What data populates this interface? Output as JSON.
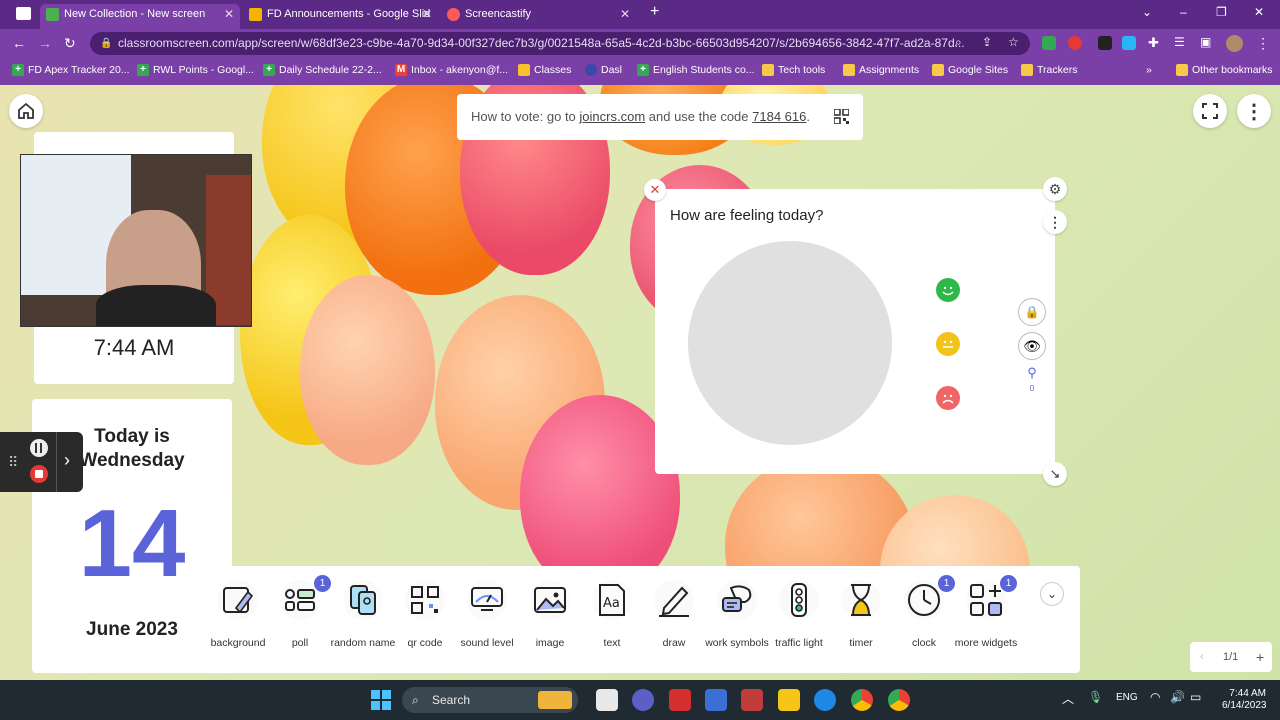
{
  "browser": {
    "tabs": [
      {
        "title": "New Collection - New screen",
        "active": true
      },
      {
        "title": "FD Announcements - Google Slid",
        "active": false
      },
      {
        "title": "Screencastify",
        "active": false
      }
    ],
    "url": "classroomscreen.com/app/screen/w/68df3e23-c9be-4a70-9d34-00f327dec7b3/g/0021548a-65a5-4c2d-b3bc-66503d954207/s/2b694656-3842-47f7-ad2a-87d...",
    "bookmarks": [
      "FD Apex Tracker 20...",
      "RWL Points - Googl...",
      "Daily Schedule 22-2...",
      "Inbox - akenyon@f...",
      "Classes",
      "Dasl",
      "English Students co...",
      "Tech tools",
      "Assignments",
      "Google Sites",
      "Trackers"
    ],
    "bookmarks_overflow": "»",
    "other_bookmarks": "Other bookmarks"
  },
  "vote": {
    "prefix": "How to vote: go to ",
    "site": "joincrs.com",
    "middle": " and use the code ",
    "code": "7184 616",
    "suffix": "."
  },
  "clock": {
    "time": "7:44 AM"
  },
  "date": {
    "line1": "Today is",
    "line2": "Wednesday",
    "day": "14",
    "month_year": "June 2023"
  },
  "poll": {
    "question": "How are feeling today?",
    "participants": "0",
    "options": [
      {
        "icon": "happy-face-icon",
        "color": "#2db84a"
      },
      {
        "icon": "neutral-face-icon",
        "color": "#f2c31a"
      },
      {
        "icon": "sad-face-icon",
        "color": "#f06666"
      }
    ]
  },
  "toolbar": {
    "tools": [
      {
        "label": "background",
        "badge": ""
      },
      {
        "label": "poll",
        "badge": "1"
      },
      {
        "label": "random name",
        "badge": ""
      },
      {
        "label": "qr code",
        "badge": ""
      },
      {
        "label": "sound level",
        "badge": ""
      },
      {
        "label": "image",
        "badge": ""
      },
      {
        "label": "text",
        "badge": ""
      },
      {
        "label": "draw",
        "badge": ""
      },
      {
        "label": "work symbols",
        "badge": ""
      },
      {
        "label": "traffic light",
        "badge": ""
      },
      {
        "label": "timer",
        "badge": ""
      },
      {
        "label": "clock",
        "badge": "1"
      },
      {
        "label": "more widgets",
        "badge": "1"
      }
    ]
  },
  "pager": {
    "label": "1/1",
    "add": "+",
    "prev": "‹"
  },
  "taskbar": {
    "search": "Search",
    "lang": "ENG",
    "time": "7:44 AM",
    "date": "6/14/2023"
  },
  "colors": {
    "accent": "#5b63d8",
    "chrome_dark": "#5b2a86",
    "chrome": "#7b3fa8"
  }
}
